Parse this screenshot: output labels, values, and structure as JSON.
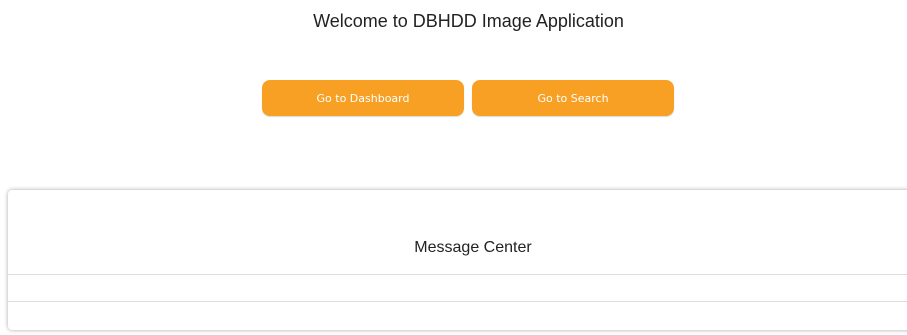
{
  "header": {
    "welcome_text": "Welcome to DBHDD Image Application"
  },
  "actions": {
    "dashboard_label": "Go to Dashboard",
    "search_label": "Go to Search"
  },
  "message_center": {
    "title": "Message Center",
    "messages": [
      "",
      ""
    ]
  },
  "colors": {
    "button_accent": "#f7a024",
    "button_text": "#ffffff"
  }
}
